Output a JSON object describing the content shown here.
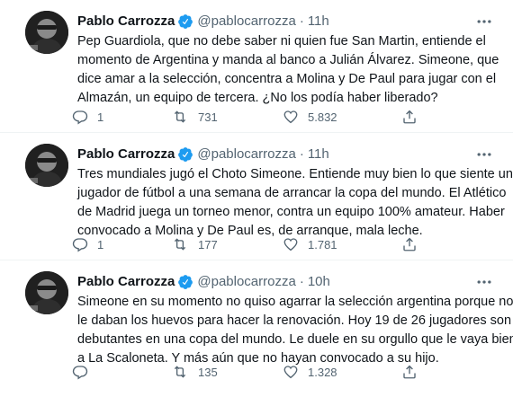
{
  "tweets": [
    {
      "name": "Pablo Carrozza",
      "handle": "@pablocarrozza",
      "separator": "·",
      "time": "11h",
      "lines": [
        "Pep Guardiola, que no debe saber ni quien fue San Martin, entiende el",
        "momento de Argentina y manda al banco a Julián Álvarez. Simeone, que",
        "dice amar a la selección, concentra a Molina y De Paul para jugar con el",
        "Almazán, un equipo de tercera. ¿No los podía haber liberado?"
      ],
      "replies": "1",
      "retweets": "731",
      "likes": "5.832"
    },
    {
      "name": "Pablo Carrozza",
      "handle": "@pablocarrozza",
      "separator": "·",
      "time": "11h",
      "lines": [
        "Tres mundiales jugó el Choto Simeone. Entiende muy bien lo que siente un",
        "jugador de fútbol a una semana de arrancar la copa del mundo. El Atlético",
        "de Madrid juega un torneo menor, contra un equipo 100% amateur. Haber",
        "convocado a Molina y De Paul es, de arranque, mala leche."
      ],
      "replies": "1",
      "retweets": "177",
      "likes": "1.781"
    },
    {
      "name": "Pablo Carrozza",
      "handle": "@pablocarrozza",
      "separator": "·",
      "time": "10h",
      "lines": [
        "Simeone en su momento no quiso agarrar la selección argentina porque no",
        "le daban los huevos para hacer la renovación. Hoy 19 de 26 jugadores son",
        "debutantes en una copa del mundo. Le duele en su orgullo que le vaya bien",
        "a La Scaloneta. Y más aún que no hayan convocado a su hijo."
      ],
      "replies": "",
      "retweets": "135",
      "likes": "1.328"
    }
  ],
  "icons": {
    "reply": "reply-icon",
    "retweet": "retweet-icon",
    "like": "heart-icon",
    "share": "share-icon",
    "more": "more-options-icon",
    "verified": "verified-badge-icon"
  },
  "colors": {
    "text": "#0f1419",
    "secondary": "#536471",
    "verified": "#1d9bf0",
    "divider": "#eff3f4"
  }
}
